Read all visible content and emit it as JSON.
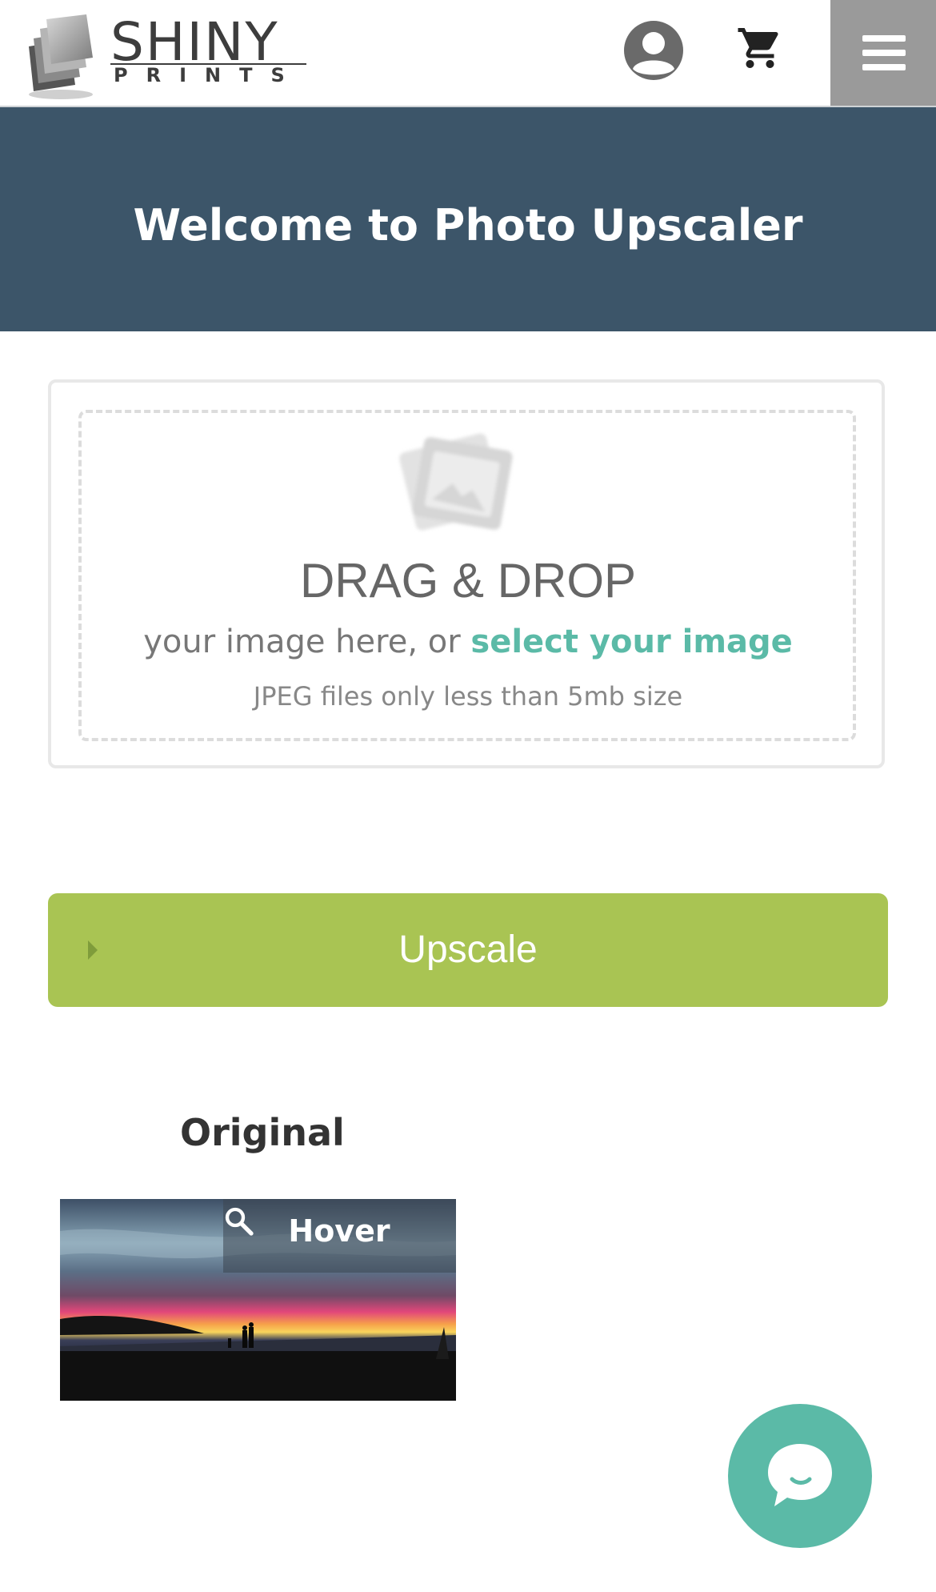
{
  "header": {
    "logo": {
      "name": "SHINY",
      "sub": "PRINTS"
    },
    "icons": {
      "account": "account-circle-icon",
      "cart": "shopping-cart-icon",
      "menu": "hamburger-menu-icon"
    }
  },
  "hero": {
    "title": "Welcome to Photo Upscaler"
  },
  "upload": {
    "icon": "photos-icon",
    "title": "DRAG & DROP",
    "line_prefix": "your image here, or ",
    "line_link": "select your image",
    "note": "JPEG files only less than 5mb size"
  },
  "action": {
    "upscale_label": "Upscale"
  },
  "preview": {
    "title": "Original",
    "hover_label": "Hover",
    "zoom_icon": "magnifier-icon"
  },
  "chat": {
    "icon": "chat-bubble-icon"
  },
  "colors": {
    "hero_bg": "#3c5569",
    "accent": "#5bbaa7",
    "button_green": "#a9c453",
    "menu_gray": "#9a9a9a"
  }
}
